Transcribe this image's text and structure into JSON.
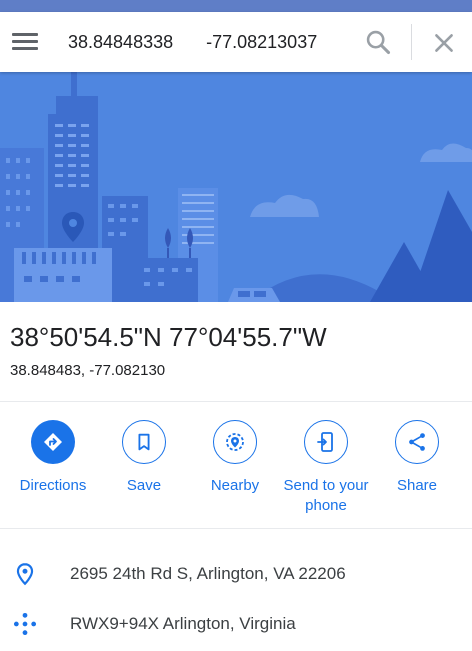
{
  "search": {
    "value": "38.84848338 -77.08213037"
  },
  "place": {
    "title": "38°50'54.5\"N 77°04'55.7\"W",
    "coordinates": "38.848483, -77.082130"
  },
  "actions": [
    {
      "label": "Directions",
      "icon": "directions-icon"
    },
    {
      "label": "Save",
      "icon": "bookmark-icon"
    },
    {
      "label": "Nearby",
      "icon": "nearby-icon"
    },
    {
      "label": "Send to your phone",
      "icon": "send-to-phone-icon"
    },
    {
      "label": "Share",
      "icon": "share-icon"
    }
  ],
  "details": {
    "address": "2695 24th Rd S, Arlington, VA 22206",
    "plus_code": "RWX9+94X Arlington, Virginia"
  },
  "colors": {
    "accent": "#1a73e8",
    "hero_background": "#4f86e0"
  }
}
